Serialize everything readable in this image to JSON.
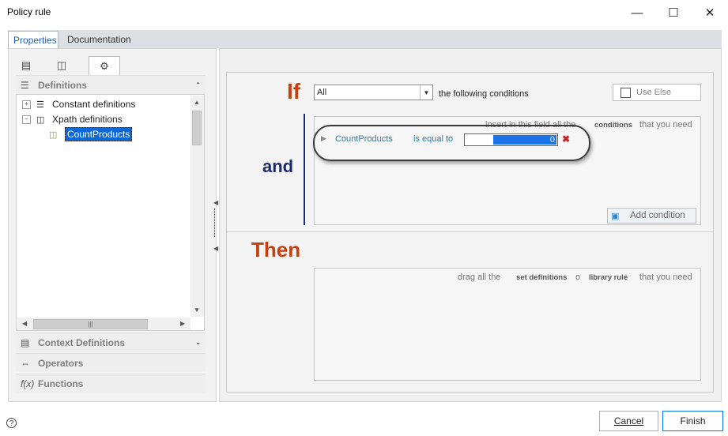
{
  "window": {
    "title": "Policy rule",
    "minimize": "—",
    "maximize": "☐",
    "close": "✕"
  },
  "tabs": [
    {
      "label": "Properties"
    },
    {
      "label": "Documentation"
    }
  ],
  "left": {
    "toolbar_icons": [
      "page-icon",
      "tree-icon",
      "gear-icon"
    ],
    "definitions_header": "Definitions",
    "tree": {
      "constant": "Constant definitions",
      "xpath": "Xpath definitions",
      "selected_child": "CountProducts"
    },
    "sections": {
      "context": "Context Definitions",
      "operators": "Operators",
      "functions": "Functions"
    }
  },
  "rule": {
    "if_label": "If",
    "and_label": "and",
    "then_label": "Then",
    "match_select": "All",
    "following_text": "the following conditions",
    "use_else": "Use Else",
    "cond_hint_1": "insert in this field all the",
    "cond_hint_2": "conditions",
    "cond_hint_3": "that you need",
    "condition": {
      "field": "CountProducts",
      "operator": "is equal to",
      "value": "0"
    },
    "add_condition": "Add condition",
    "act_hint_1": "drag all the",
    "act_hint_2": "set definitions",
    "act_hint_3": "o",
    "act_hint_4": "library rule",
    "act_hint_5": "that you need"
  },
  "footer": {
    "cancel": "Cancel",
    "finish": "Finish",
    "help": "?"
  },
  "colors": {
    "keyword": "#c5400f",
    "and": "#1e2a6e",
    "selection": "#0a68d8"
  }
}
